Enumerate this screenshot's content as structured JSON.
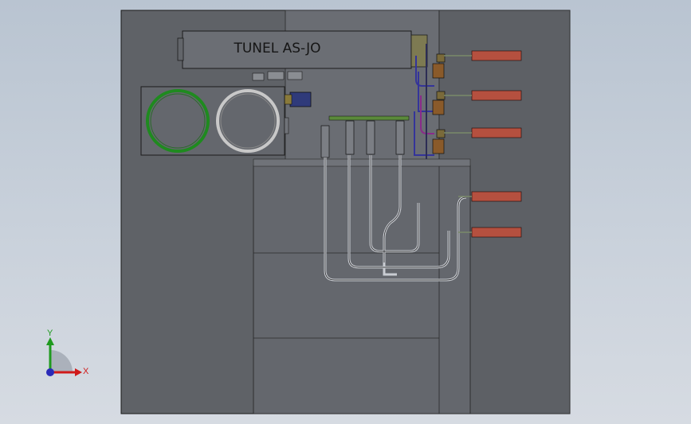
{
  "window": {
    "kind": "cad-model-viewport"
  },
  "model": {
    "label": "TUNEL AS-JO"
  },
  "triad": {
    "y_axis_label": "Y",
    "x_axis_label": "X"
  },
  "colors": {
    "background_top": "#b9c4d1",
    "panel_face": "#5e6166",
    "panel_inner": "#696c72",
    "cable_red": "#b5503f",
    "ring_green": "#1f8a1f",
    "ring_silver": "#c8c8c8",
    "pipe_blue": "#34349a",
    "pipe_purple": "#8a2b8a",
    "axis_green": "#1f9a1f",
    "axis_red": "#d01a1a",
    "axis_blue": "#2a2ab8"
  }
}
